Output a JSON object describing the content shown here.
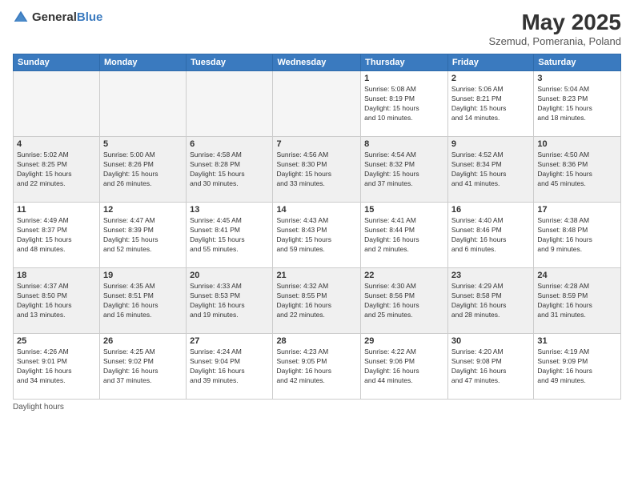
{
  "header": {
    "logo": {
      "general": "General",
      "blue": "Blue"
    },
    "title": "May 2025",
    "subtitle": "Szemud, Pomerania, Poland"
  },
  "weekdays": [
    "Sunday",
    "Monday",
    "Tuesday",
    "Wednesday",
    "Thursday",
    "Friday",
    "Saturday"
  ],
  "weeks": [
    [
      {
        "day": "",
        "info": "",
        "empty": true
      },
      {
        "day": "",
        "info": "",
        "empty": true
      },
      {
        "day": "",
        "info": "",
        "empty": true
      },
      {
        "day": "",
        "info": "",
        "empty": true
      },
      {
        "day": "1",
        "info": "Sunrise: 5:08 AM\nSunset: 8:19 PM\nDaylight: 15 hours\nand 10 minutes."
      },
      {
        "day": "2",
        "info": "Sunrise: 5:06 AM\nSunset: 8:21 PM\nDaylight: 15 hours\nand 14 minutes."
      },
      {
        "day": "3",
        "info": "Sunrise: 5:04 AM\nSunset: 8:23 PM\nDaylight: 15 hours\nand 18 minutes."
      }
    ],
    [
      {
        "day": "4",
        "info": "Sunrise: 5:02 AM\nSunset: 8:25 PM\nDaylight: 15 hours\nand 22 minutes."
      },
      {
        "day": "5",
        "info": "Sunrise: 5:00 AM\nSunset: 8:26 PM\nDaylight: 15 hours\nand 26 minutes."
      },
      {
        "day": "6",
        "info": "Sunrise: 4:58 AM\nSunset: 8:28 PM\nDaylight: 15 hours\nand 30 minutes."
      },
      {
        "day": "7",
        "info": "Sunrise: 4:56 AM\nSunset: 8:30 PM\nDaylight: 15 hours\nand 33 minutes."
      },
      {
        "day": "8",
        "info": "Sunrise: 4:54 AM\nSunset: 8:32 PM\nDaylight: 15 hours\nand 37 minutes."
      },
      {
        "day": "9",
        "info": "Sunrise: 4:52 AM\nSunset: 8:34 PM\nDaylight: 15 hours\nand 41 minutes."
      },
      {
        "day": "10",
        "info": "Sunrise: 4:50 AM\nSunset: 8:36 PM\nDaylight: 15 hours\nand 45 minutes."
      }
    ],
    [
      {
        "day": "11",
        "info": "Sunrise: 4:49 AM\nSunset: 8:37 PM\nDaylight: 15 hours\nand 48 minutes."
      },
      {
        "day": "12",
        "info": "Sunrise: 4:47 AM\nSunset: 8:39 PM\nDaylight: 15 hours\nand 52 minutes."
      },
      {
        "day": "13",
        "info": "Sunrise: 4:45 AM\nSunset: 8:41 PM\nDaylight: 15 hours\nand 55 minutes."
      },
      {
        "day": "14",
        "info": "Sunrise: 4:43 AM\nSunset: 8:43 PM\nDaylight: 15 hours\nand 59 minutes."
      },
      {
        "day": "15",
        "info": "Sunrise: 4:41 AM\nSunset: 8:44 PM\nDaylight: 16 hours\nand 2 minutes."
      },
      {
        "day": "16",
        "info": "Sunrise: 4:40 AM\nSunset: 8:46 PM\nDaylight: 16 hours\nand 6 minutes."
      },
      {
        "day": "17",
        "info": "Sunrise: 4:38 AM\nSunset: 8:48 PM\nDaylight: 16 hours\nand 9 minutes."
      }
    ],
    [
      {
        "day": "18",
        "info": "Sunrise: 4:37 AM\nSunset: 8:50 PM\nDaylight: 16 hours\nand 13 minutes."
      },
      {
        "day": "19",
        "info": "Sunrise: 4:35 AM\nSunset: 8:51 PM\nDaylight: 16 hours\nand 16 minutes."
      },
      {
        "day": "20",
        "info": "Sunrise: 4:33 AM\nSunset: 8:53 PM\nDaylight: 16 hours\nand 19 minutes."
      },
      {
        "day": "21",
        "info": "Sunrise: 4:32 AM\nSunset: 8:55 PM\nDaylight: 16 hours\nand 22 minutes."
      },
      {
        "day": "22",
        "info": "Sunrise: 4:30 AM\nSunset: 8:56 PM\nDaylight: 16 hours\nand 25 minutes."
      },
      {
        "day": "23",
        "info": "Sunrise: 4:29 AM\nSunset: 8:58 PM\nDaylight: 16 hours\nand 28 minutes."
      },
      {
        "day": "24",
        "info": "Sunrise: 4:28 AM\nSunset: 8:59 PM\nDaylight: 16 hours\nand 31 minutes."
      }
    ],
    [
      {
        "day": "25",
        "info": "Sunrise: 4:26 AM\nSunset: 9:01 PM\nDaylight: 16 hours\nand 34 minutes."
      },
      {
        "day": "26",
        "info": "Sunrise: 4:25 AM\nSunset: 9:02 PM\nDaylight: 16 hours\nand 37 minutes."
      },
      {
        "day": "27",
        "info": "Sunrise: 4:24 AM\nSunset: 9:04 PM\nDaylight: 16 hours\nand 39 minutes."
      },
      {
        "day": "28",
        "info": "Sunrise: 4:23 AM\nSunset: 9:05 PM\nDaylight: 16 hours\nand 42 minutes."
      },
      {
        "day": "29",
        "info": "Sunrise: 4:22 AM\nSunset: 9:06 PM\nDaylight: 16 hours\nand 44 minutes."
      },
      {
        "day": "30",
        "info": "Sunrise: 4:20 AM\nSunset: 9:08 PM\nDaylight: 16 hours\nand 47 minutes."
      },
      {
        "day": "31",
        "info": "Sunrise: 4:19 AM\nSunset: 9:09 PM\nDaylight: 16 hours\nand 49 minutes."
      }
    ]
  ],
  "footer": {
    "note": "Daylight hours"
  }
}
